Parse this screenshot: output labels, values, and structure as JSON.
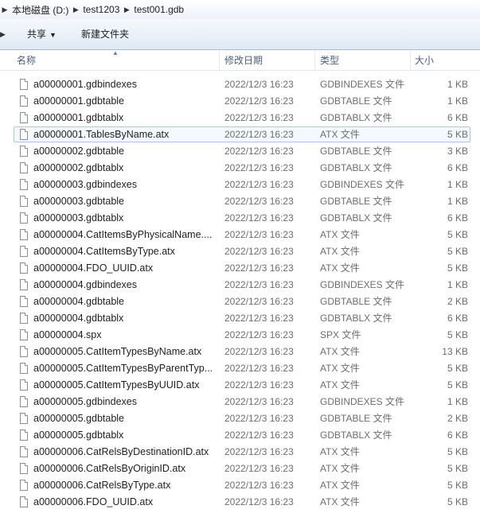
{
  "breadcrumb": [
    "本地磁盘 (D:)",
    "test1203",
    "test001.gdb"
  ],
  "toolbar": {
    "share_label": "共享",
    "new_folder_label": "新建文件夹"
  },
  "columns": {
    "name": "名称",
    "date": "修改日期",
    "type": "类型",
    "size": "大小"
  },
  "selected_index": 3,
  "files": [
    {
      "name": "a00000001.gdbindexes",
      "date": "2022/12/3 16:23",
      "type": "GDBINDEXES 文件",
      "size": "1 KB"
    },
    {
      "name": "a00000001.gdbtable",
      "date": "2022/12/3 16:23",
      "type": "GDBTABLE 文件",
      "size": "1 KB"
    },
    {
      "name": "a00000001.gdbtablx",
      "date": "2022/12/3 16:23",
      "type": "GDBTABLX 文件",
      "size": "6 KB"
    },
    {
      "name": "a00000001.TablesByName.atx",
      "date": "2022/12/3 16:23",
      "type": "ATX 文件",
      "size": "5 KB"
    },
    {
      "name": "a00000002.gdbtable",
      "date": "2022/12/3 16:23",
      "type": "GDBTABLE 文件",
      "size": "3 KB"
    },
    {
      "name": "a00000002.gdbtablx",
      "date": "2022/12/3 16:23",
      "type": "GDBTABLX 文件",
      "size": "6 KB"
    },
    {
      "name": "a00000003.gdbindexes",
      "date": "2022/12/3 16:23",
      "type": "GDBINDEXES 文件",
      "size": "1 KB"
    },
    {
      "name": "a00000003.gdbtable",
      "date": "2022/12/3 16:23",
      "type": "GDBTABLE 文件",
      "size": "1 KB"
    },
    {
      "name": "a00000003.gdbtablx",
      "date": "2022/12/3 16:23",
      "type": "GDBTABLX 文件",
      "size": "6 KB"
    },
    {
      "name": "a00000004.CatItemsByPhysicalName....",
      "date": "2022/12/3 16:23",
      "type": "ATX 文件",
      "size": "5 KB"
    },
    {
      "name": "a00000004.CatItemsByType.atx",
      "date": "2022/12/3 16:23",
      "type": "ATX 文件",
      "size": "5 KB"
    },
    {
      "name": "a00000004.FDO_UUID.atx",
      "date": "2022/12/3 16:23",
      "type": "ATX 文件",
      "size": "5 KB"
    },
    {
      "name": "a00000004.gdbindexes",
      "date": "2022/12/3 16:23",
      "type": "GDBINDEXES 文件",
      "size": "1 KB"
    },
    {
      "name": "a00000004.gdbtable",
      "date": "2022/12/3 16:23",
      "type": "GDBTABLE 文件",
      "size": "2 KB"
    },
    {
      "name": "a00000004.gdbtablx",
      "date": "2022/12/3 16:23",
      "type": "GDBTABLX 文件",
      "size": "6 KB"
    },
    {
      "name": "a00000004.spx",
      "date": "2022/12/3 16:23",
      "type": "SPX 文件",
      "size": "5 KB"
    },
    {
      "name": "a00000005.CatItemTypesByName.atx",
      "date": "2022/12/3 16:23",
      "type": "ATX 文件",
      "size": "13 KB"
    },
    {
      "name": "a00000005.CatItemTypesByParentTyp...",
      "date": "2022/12/3 16:23",
      "type": "ATX 文件",
      "size": "5 KB"
    },
    {
      "name": "a00000005.CatItemTypesByUUID.atx",
      "date": "2022/12/3 16:23",
      "type": "ATX 文件",
      "size": "5 KB"
    },
    {
      "name": "a00000005.gdbindexes",
      "date": "2022/12/3 16:23",
      "type": "GDBINDEXES 文件",
      "size": "1 KB"
    },
    {
      "name": "a00000005.gdbtable",
      "date": "2022/12/3 16:23",
      "type": "GDBTABLE 文件",
      "size": "2 KB"
    },
    {
      "name": "a00000005.gdbtablx",
      "date": "2022/12/3 16:23",
      "type": "GDBTABLX 文件",
      "size": "6 KB"
    },
    {
      "name": "a00000006.CatRelsByDestinationID.atx",
      "date": "2022/12/3 16:23",
      "type": "ATX 文件",
      "size": "5 KB"
    },
    {
      "name": "a00000006.CatRelsByOriginID.atx",
      "date": "2022/12/3 16:23",
      "type": "ATX 文件",
      "size": "5 KB"
    },
    {
      "name": "a00000006.CatRelsByType.atx",
      "date": "2022/12/3 16:23",
      "type": "ATX 文件",
      "size": "5 KB"
    },
    {
      "name": "a00000006.FDO_UUID.atx",
      "date": "2022/12/3 16:23",
      "type": "ATX 文件",
      "size": "5 KB"
    }
  ]
}
